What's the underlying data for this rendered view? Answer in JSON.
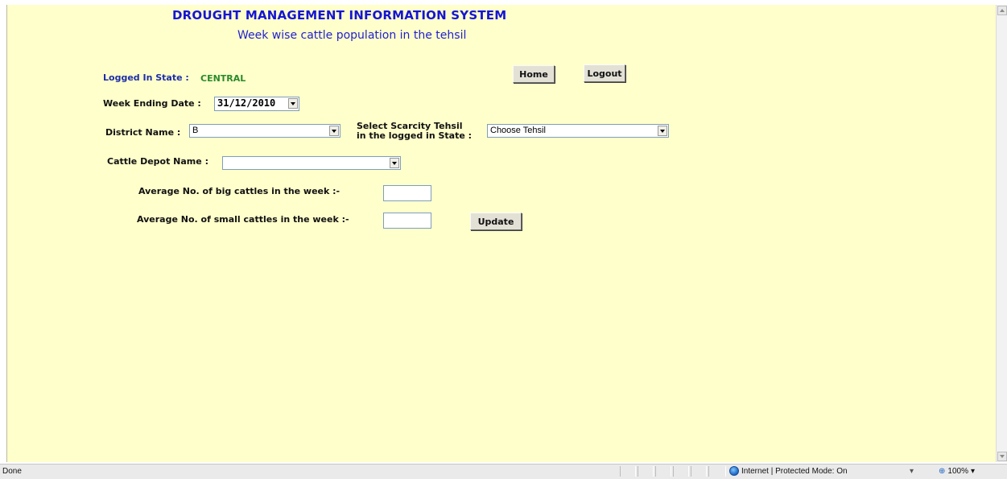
{
  "header": {
    "title": "DROUGHT MANAGEMENT INFORMATION SYSTEM",
    "subtitle": "Week wise cattle population in the tehsil"
  },
  "session": {
    "logged_label": "Logged In State :",
    "state_value": "CENTRAL",
    "home_label": "Home",
    "logout_label": "Logout"
  },
  "form": {
    "week_label": "Week Ending Date :",
    "week_value": "31/12/2010",
    "district_label": "District Name :",
    "district_value": "B",
    "tehsil_label_line1": "Select Scarcity Tehsil",
    "tehsil_label_line2": "in the logged in State :",
    "tehsil_value": "Choose Tehsil",
    "depot_label": "Cattle Depot Name :",
    "depot_value": "",
    "big_label": "Average No. of big cattles in the week :-",
    "big_value": "",
    "small_label": "Average No. of small cattles in the week :-",
    "small_value": "",
    "update_label": "Update"
  },
  "statusbar": {
    "status_text": "Done",
    "zone_text": "Internet | Protected Mode: On",
    "zoom_text": "100%"
  }
}
